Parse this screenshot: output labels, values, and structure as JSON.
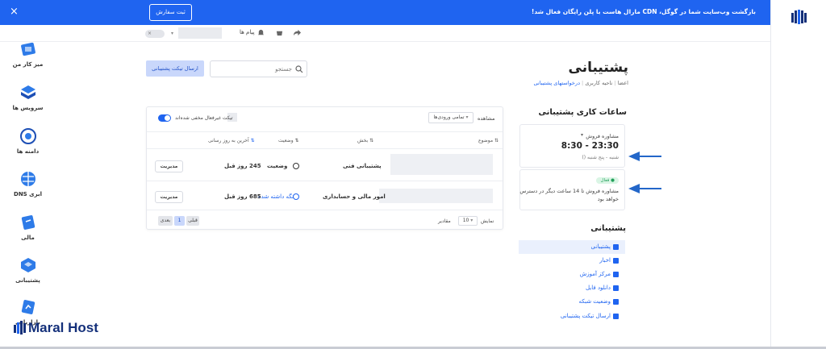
{
  "banner": {
    "message": "بازگشت وب‌سایت شما در گوگل، CDN مارال هاست با پلن رایگان فعال شد!",
    "cta": "ثبت سفارش",
    "close": "×"
  },
  "sidebar": {
    "items": [
      {
        "label": "میز کار من",
        "icon": "dashboard-icon"
      },
      {
        "label": "سرویس ها",
        "icon": "services-icon"
      },
      {
        "label": "دامنه ها",
        "icon": "domain-icon"
      },
      {
        "label": "DNS ابری",
        "icon": "cloud-dns-icon"
      },
      {
        "label": "مالی",
        "icon": "finance-icon"
      },
      {
        "label": "پشتیبانی",
        "icon": "support-icon"
      },
      {
        "label": "بازاریابی",
        "icon": "marketing-icon"
      }
    ]
  },
  "toolbar": {
    "messages": "پیام ها",
    "toggle": "×"
  },
  "page": {
    "title": "پشتیبانی",
    "breadcrumb": [
      "اعضا",
      "ناحیه کاربری",
      "درخواستهای پشتیبانی"
    ]
  },
  "search": {
    "placeholder": "جستجو"
  },
  "send_ticket": "ارسال تیکت پشتیبانی",
  "hours": {
    "title": "ساعات کاری پشتیبانی",
    "card1": {
      "label": "مشاوره فروش",
      "time": "8:30 - 23:30",
      "days": "شنبه - پنج شنبه ()"
    },
    "card2": {
      "status": "فعال",
      "text1": "مشاوره فروش تا 14 ساعت دیگر در دسترس",
      "text2": "خواهد بود"
    }
  },
  "support_menu": {
    "title": "پشتیبانی",
    "items": [
      "پشتیبانی",
      "اخبار",
      "مرکز آموزش",
      "دانلود فایل",
      "وضعیت شبکه",
      "ارسال تیکت پشتیبانی"
    ]
  },
  "table": {
    "show_label": "مشاهده",
    "filter": "تمامی ورودی‌ها",
    "hide_inactive": "تیکت غیرفعال مخفی شده‌اند",
    "headers": [
      "موضوع",
      "بخش",
      "وضعیت",
      "آخرین به روز رسانی"
    ],
    "rows": [
      {
        "dept": "پشتیبانی فنی",
        "status": "وضعیت",
        "updated": "245 روز قبل",
        "action": "مدیریت"
      },
      {
        "dept": "امور مالی و حسابداری",
        "status": "نگه داشته شده",
        "updated": "685 روز قبل",
        "action": "مدیریت"
      }
    ],
    "show": "نمایش",
    "per_page": "10",
    "per_page_suffix": "مقادیر",
    "pagination": {
      "prev": "قبلی",
      "page": "1",
      "next": "بعدی"
    }
  },
  "brand": "Maral Host"
}
